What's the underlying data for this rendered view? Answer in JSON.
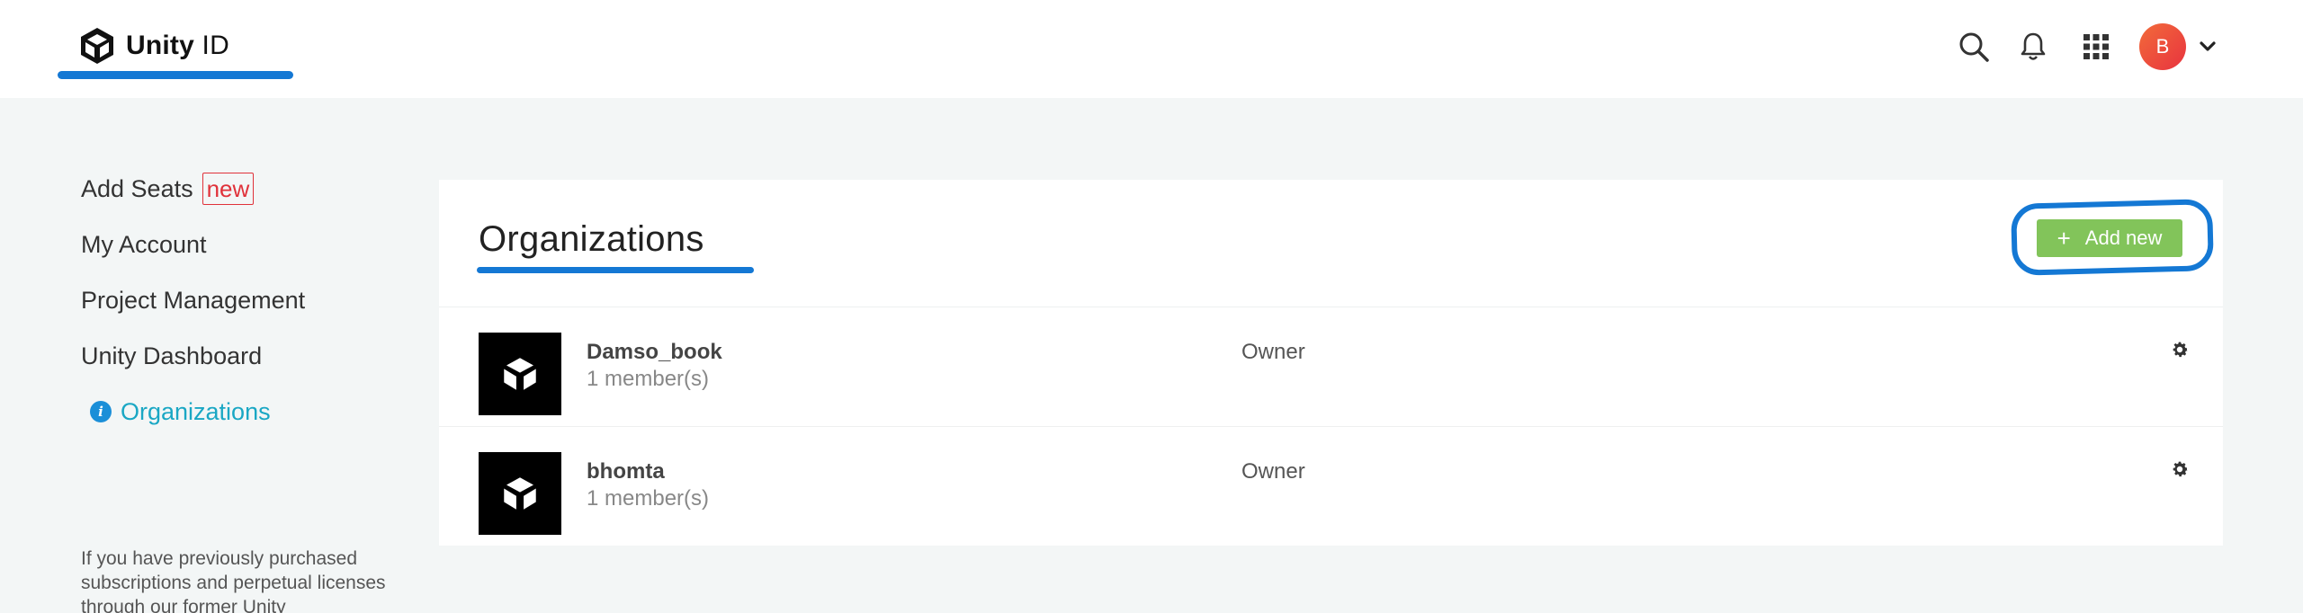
{
  "header": {
    "logo_bold": "Unity",
    "logo_light": "ID",
    "icons": [
      "search-icon",
      "bell-icon",
      "apps-grid-icon"
    ],
    "avatar_initial": "B",
    "avatar_color": "#ec4a3c"
  },
  "sidebar": {
    "items": [
      {
        "label": "Add Seats",
        "badge": "new"
      },
      {
        "label": "My Account"
      },
      {
        "label": "Project Management"
      },
      {
        "label": "Unity Dashboard"
      },
      {
        "label": "Organizations",
        "active": true
      }
    ],
    "note": "If you have previously purchased subscriptions and perpetual licenses through our former Unity"
  },
  "main": {
    "title": "Organizations",
    "add_button": {
      "icon": "+",
      "label": "Add new"
    },
    "organizations": [
      {
        "name": "Damso_book",
        "members": "1 member(s)",
        "role": "Owner"
      },
      {
        "name": "bhomta",
        "members": "1 member(s)",
        "role": "Owner"
      }
    ]
  },
  "colors": {
    "accent_blue": "#1478d4",
    "active_link": "#1aa7c4",
    "button_green": "#82c45a",
    "badge_red": "#e0323a"
  }
}
